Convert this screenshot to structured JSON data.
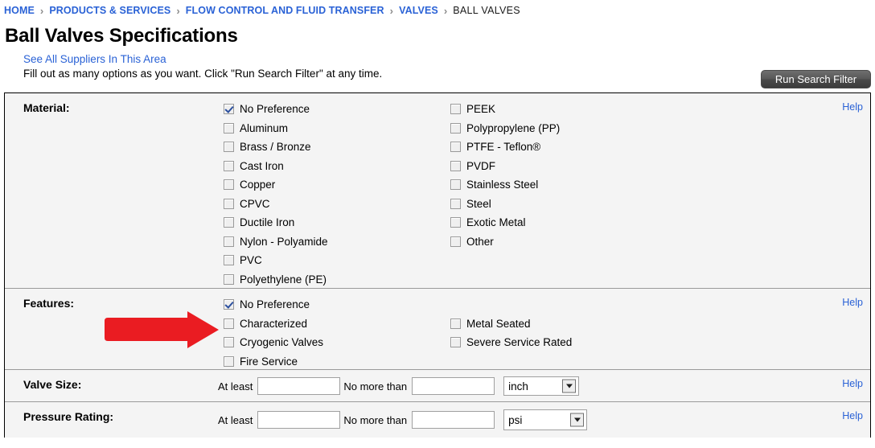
{
  "breadcrumb": {
    "separator": "›",
    "items": [
      {
        "label": "HOME",
        "current": false
      },
      {
        "label": "PRODUCTS & SERVICES",
        "current": false
      },
      {
        "label": "FLOW CONTROL AND FLUID TRANSFER",
        "current": false
      },
      {
        "label": "VALVES",
        "current": false
      },
      {
        "label": "BALL VALVES",
        "current": true
      }
    ]
  },
  "page": {
    "title": "Ball Valves Specifications",
    "suppliers_link": "See All Suppliers In This Area",
    "instructions": "Fill out as many options as you want. Click \"Run Search Filter\" at any time.",
    "run_search_label": "Run Search Filter",
    "help_label": "Help"
  },
  "sections": {
    "material": {
      "label": "Material:",
      "help": "Help",
      "column1": [
        {
          "label": "No Preference",
          "checked": true
        },
        {
          "label": "Aluminum",
          "checked": false
        },
        {
          "label": "Brass / Bronze",
          "checked": false
        },
        {
          "label": "Cast Iron",
          "checked": false
        },
        {
          "label": "Copper",
          "checked": false
        },
        {
          "label": "CPVC",
          "checked": false
        },
        {
          "label": "Ductile Iron",
          "checked": false
        },
        {
          "label": "Nylon - Polyamide",
          "checked": false
        },
        {
          "label": "PVC",
          "checked": false
        },
        {
          "label": "Polyethylene (PE)",
          "checked": false
        }
      ],
      "column2": [
        {
          "label": "PEEK",
          "checked": false
        },
        {
          "label": "Polypropylene (PP)",
          "checked": false
        },
        {
          "label": "PTFE - Teflon®",
          "checked": false
        },
        {
          "label": "PVDF",
          "checked": false
        },
        {
          "label": "Stainless Steel",
          "checked": false
        },
        {
          "label": "Steel",
          "checked": false
        },
        {
          "label": "Exotic Metal",
          "checked": false
        },
        {
          "label": "Other",
          "checked": false
        }
      ]
    },
    "features": {
      "label": "Features:",
      "help": "Help",
      "column1": [
        {
          "label": "No Preference",
          "checked": true
        },
        {
          "label": "Characterized",
          "checked": false
        },
        {
          "label": "Cryogenic Valves",
          "checked": false
        },
        {
          "label": "Fire Service",
          "checked": false
        }
      ],
      "column2": [
        {
          "label": "Metal Seated",
          "checked": false
        },
        {
          "label": "Severe Service Rated",
          "checked": false
        }
      ]
    },
    "valve_size": {
      "label": "Valve Size:",
      "help": "Help",
      "at_least_label": "At least",
      "at_least_value": "",
      "no_more_than_label": "No more than",
      "no_more_than_value": "",
      "unit_selected": "inch"
    },
    "pressure_rating": {
      "label": "Pressure Rating:",
      "help": "Help",
      "at_least_label": "At least",
      "at_least_value": "",
      "no_more_than_label": "No more than",
      "no_more_than_value": "",
      "unit_selected": "psi"
    }
  },
  "annotation": {
    "arrow_target": "Characterized",
    "arrow_color": "#ea1c22"
  },
  "colors": {
    "link": "#2a62d6",
    "panel_bg": "#f4f4f4",
    "divider": "#9a9a9a",
    "checkbox_check": "#2b4f9e"
  }
}
